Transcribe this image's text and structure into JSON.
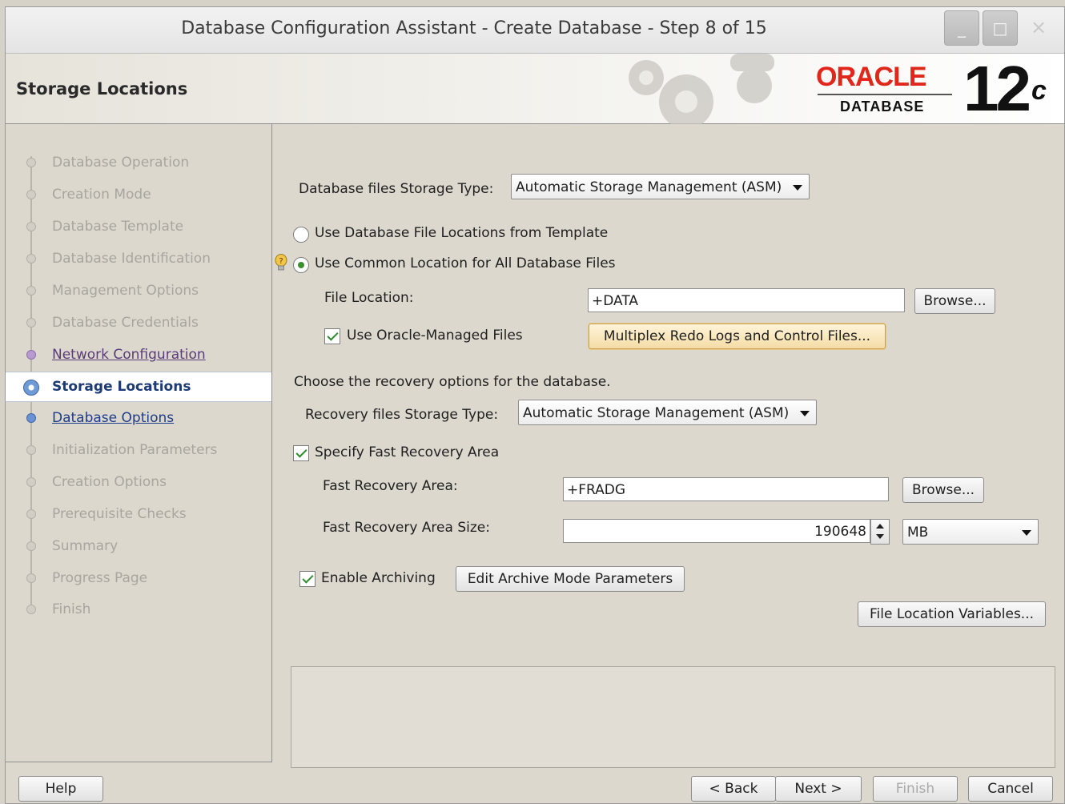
{
  "window": {
    "title": "Database Configuration Assistant - Create Database - Step 8 of 15",
    "minimize": "_",
    "maximize": "□",
    "close": "×"
  },
  "header": {
    "page_title": "Storage Locations",
    "logo_oracle": "ORACLE",
    "logo_database": "DATABASE",
    "logo_version": "12",
    "logo_version_suffix": "c"
  },
  "steps": [
    {
      "label": "Database Operation",
      "state": "done"
    },
    {
      "label": "Creation Mode",
      "state": "done"
    },
    {
      "label": "Database Template",
      "state": "done"
    },
    {
      "label": "Database Identification",
      "state": "done"
    },
    {
      "label": "Management Options",
      "state": "done"
    },
    {
      "label": "Database Credentials",
      "state": "done"
    },
    {
      "label": "Network Configuration",
      "state": "link"
    },
    {
      "label": "Storage Locations",
      "state": "current"
    },
    {
      "label": "Database Options",
      "state": "next"
    },
    {
      "label": "Initialization Parameters",
      "state": "future"
    },
    {
      "label": "Creation Options",
      "state": "future"
    },
    {
      "label": "Prerequisite Checks",
      "state": "future"
    },
    {
      "label": "Summary",
      "state": "future"
    },
    {
      "label": "Progress Page",
      "state": "future"
    },
    {
      "label": "Finish",
      "state": "future"
    }
  ],
  "storage": {
    "type_label": "Database files Storage Type:",
    "type_value": "Automatic Storage Management (ASM)",
    "radio_template_label": "Use Database File Locations from Template",
    "radio_template_selected": false,
    "radio_common_label": "Use Common Location for All Database Files",
    "radio_common_selected": true,
    "file_location_label": "File Location:",
    "file_location_value": "+DATA",
    "browse_label": "Browse...",
    "omf_label": "Use Oracle-Managed Files",
    "omf_checked": true,
    "multiplex_button": "Multiplex Redo Logs and Control Files..."
  },
  "recovery": {
    "intro": "Choose the recovery options for the database.",
    "type_label": "Recovery files Storage Type:",
    "type_value": "Automatic Storage Management (ASM)",
    "fra_specify_label": "Specify Fast Recovery Area",
    "fra_specify_checked": true,
    "fra_label": "Fast Recovery Area:",
    "fra_value": "+FRADG",
    "browse_label": "Browse...",
    "fra_size_label": "Fast Recovery Area Size:",
    "fra_size_value": "190648",
    "fra_size_unit": "MB",
    "archiving_label": "Enable Archiving",
    "archiving_checked": true,
    "edit_archive_button": "Edit Archive Mode Parameters",
    "file_location_variables_button": "File Location Variables..."
  },
  "footer": {
    "help": "Help",
    "back": "< Back",
    "next": "Next >",
    "finish": "Finish",
    "cancel": "Cancel"
  }
}
